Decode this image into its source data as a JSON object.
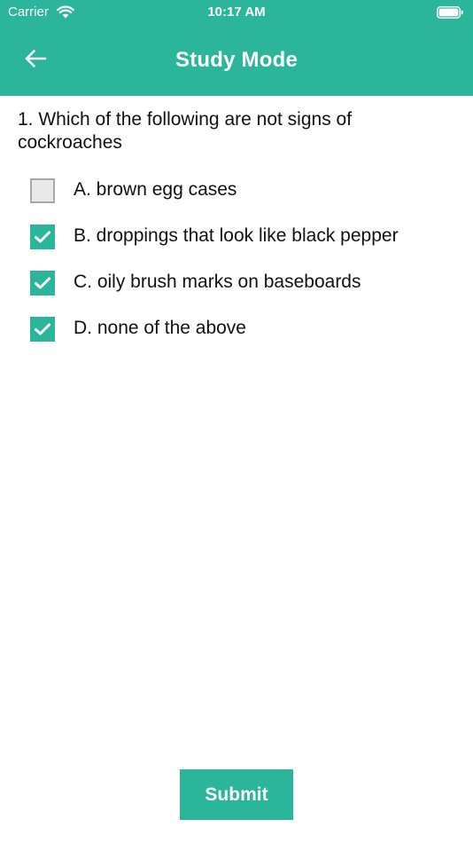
{
  "status_bar": {
    "carrier": "Carrier",
    "time": "10:17 AM",
    "wifi_icon": "wifi-icon",
    "battery_icon": "battery-icon"
  },
  "nav": {
    "title": "Study Mode",
    "back_icon": "arrow-left-icon"
  },
  "question": {
    "text": "1. Which of the following are not signs of cockroaches",
    "options": [
      {
        "label": "A. brown egg cases",
        "checked": false
      },
      {
        "label": "B. droppings that look like black pepper",
        "checked": true
      },
      {
        "label": "C. oily brush marks on baseboards",
        "checked": true
      },
      {
        "label": "D. none of the above",
        "checked": true
      }
    ]
  },
  "submit": {
    "label": "Submit"
  },
  "colors": {
    "accent": "#2bb59a",
    "checkbox_unchecked_fill": "#e9e9e9",
    "checkbox_unchecked_border": "#a9a9a9",
    "text": "#111111",
    "background": "#ffffff"
  }
}
